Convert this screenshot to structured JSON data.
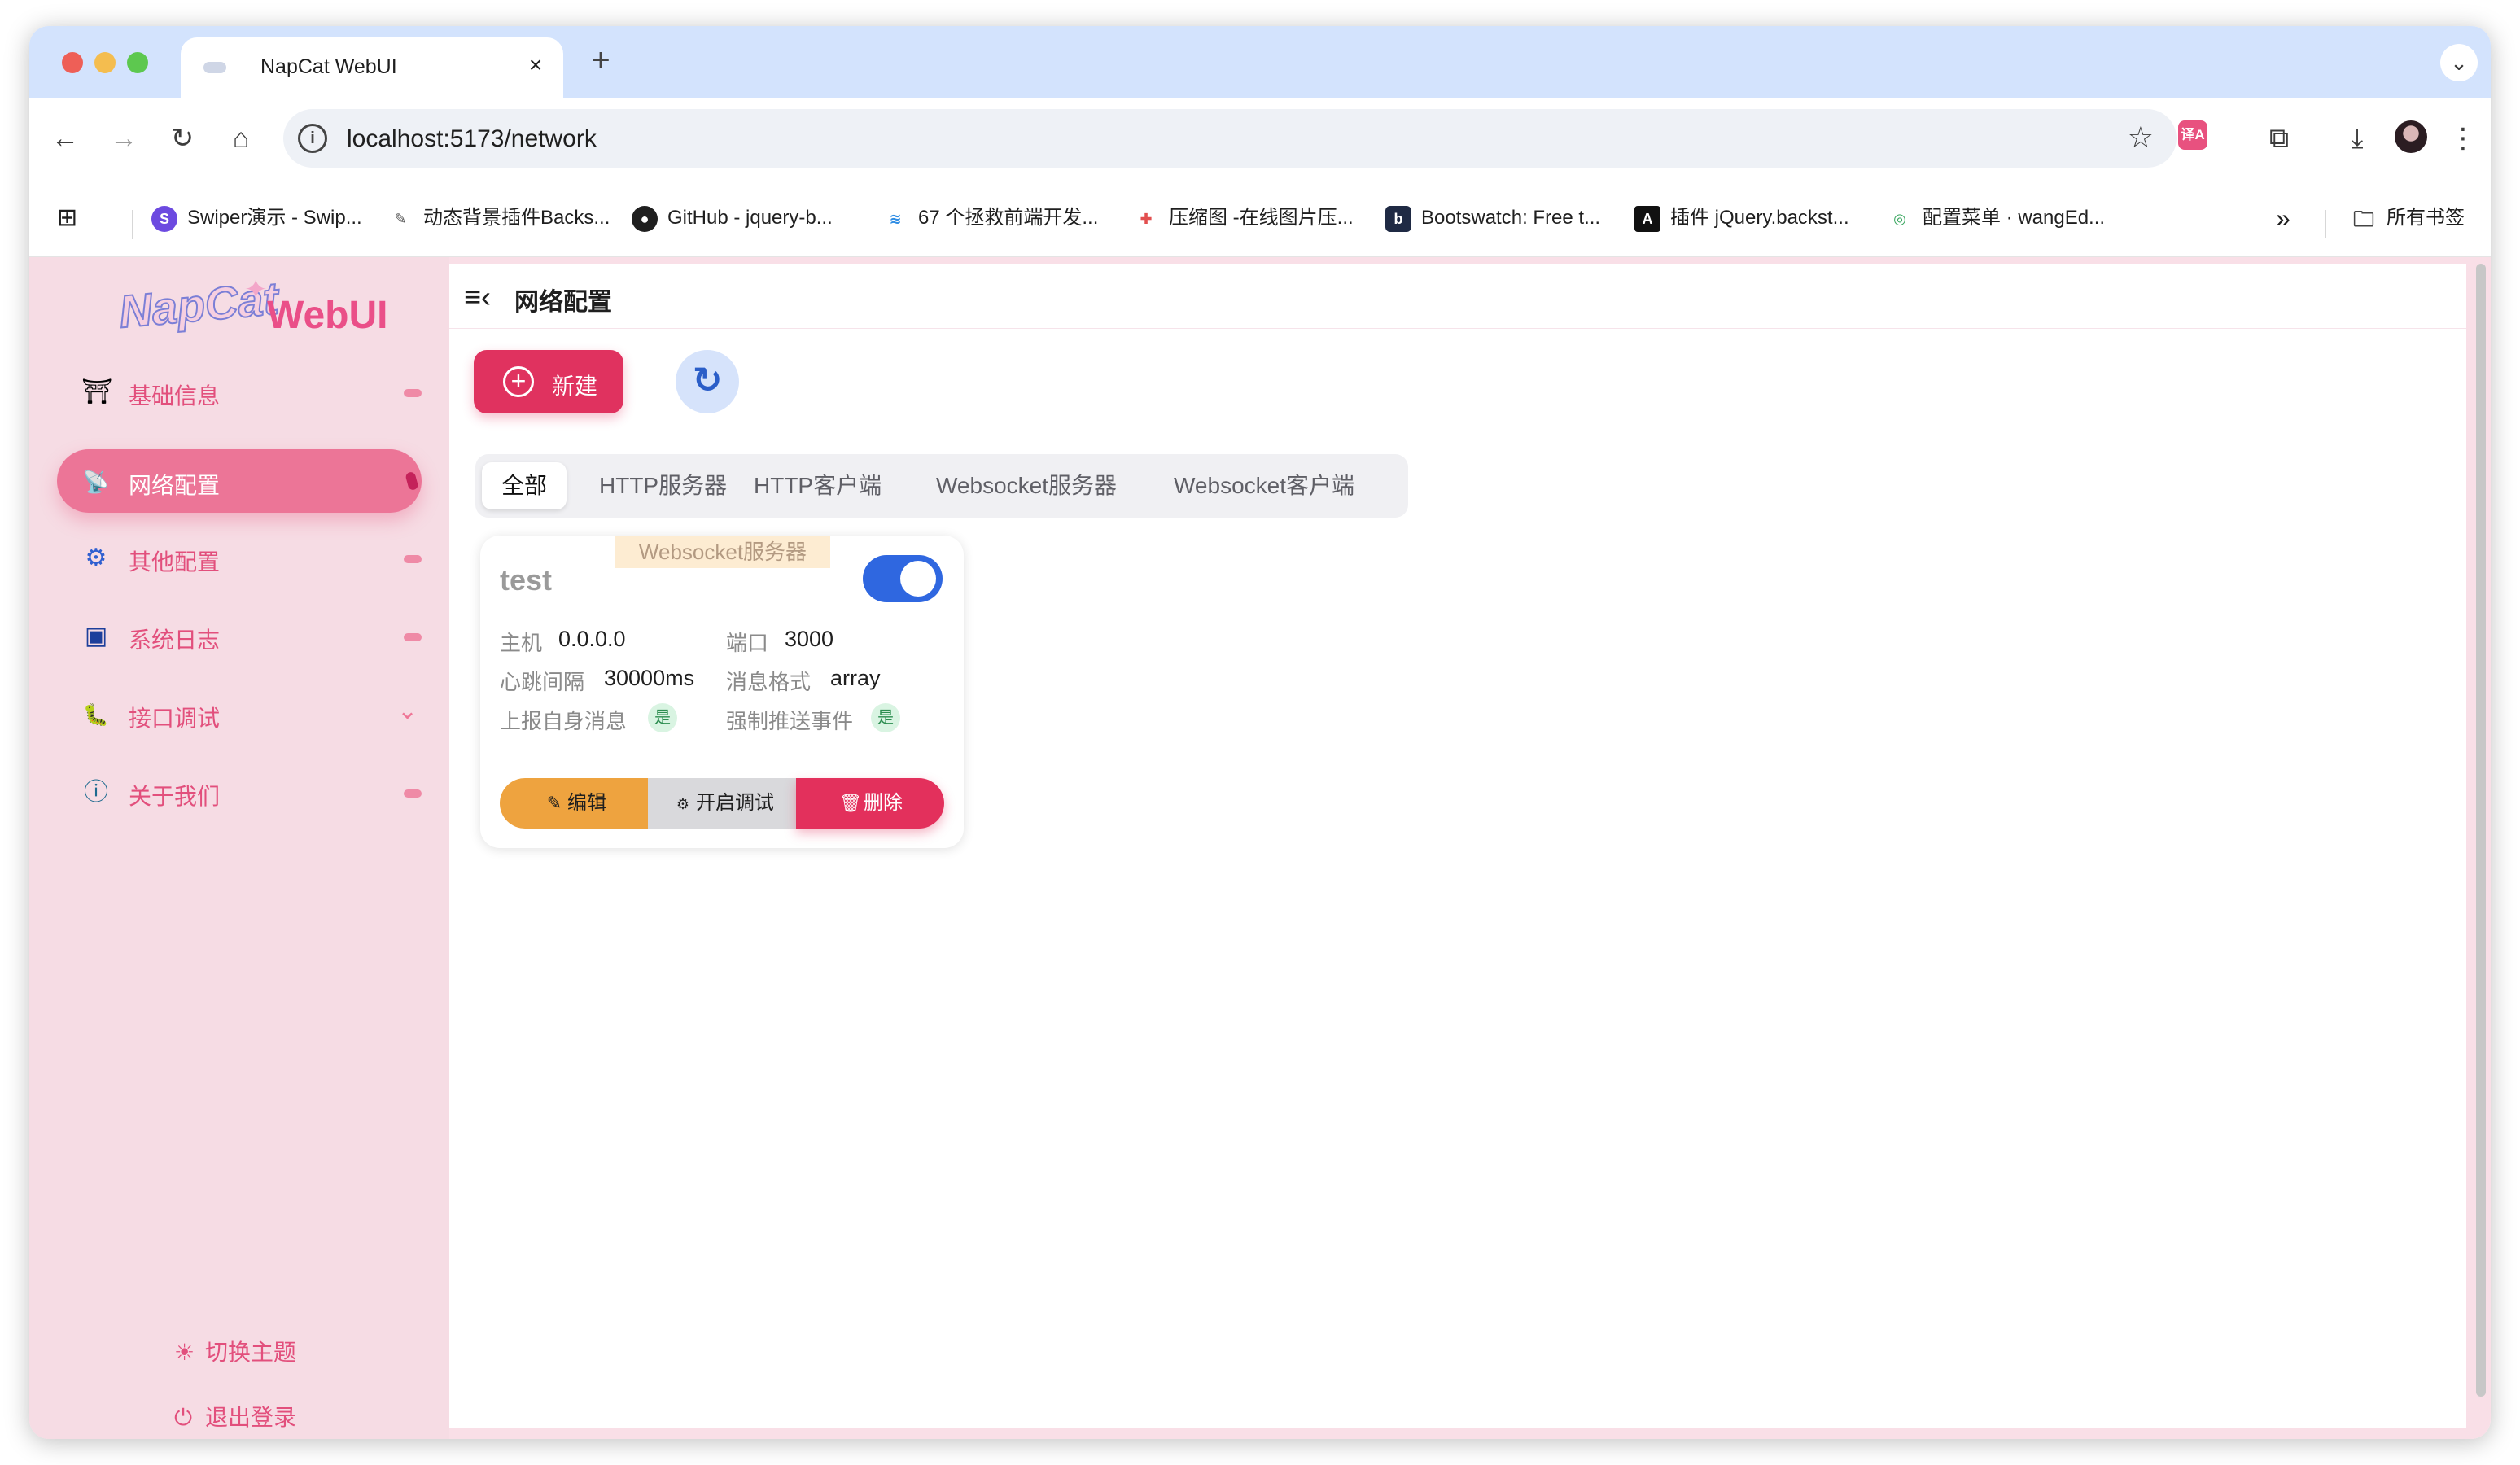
{
  "browser": {
    "tab_title": "NapCat WebUI",
    "tab_close": "×",
    "new_tab": "+",
    "tab_menu": "⌄",
    "url": "localhost:5173/network",
    "back": "←",
    "forward": "→",
    "reload": "↻",
    "home": "⌂",
    "bookmark_star": "☆",
    "extensions": "⧉",
    "download": "⤓",
    "menu": "⋮",
    "translate": "译A",
    "bookmarks": [
      {
        "label": "Swiper演示 - Swip...",
        "icon": "swiper-icon",
        "color": "#6c4ae0",
        "glyph": "S"
      },
      {
        "label": "动态背景插件Backs...",
        "icon": "pen-icon",
        "color": "#555555",
        "glyph": "✎"
      },
      {
        "label": "GitHub - jquery-b...",
        "icon": "github-icon",
        "color": "#1f1f1f",
        "glyph": "●"
      },
      {
        "label": "67 个拯救前端开发...",
        "icon": "stack-icon",
        "color": "#2f8de4",
        "glyph": "≋"
      },
      {
        "label": "压缩图 -在线图片压...",
        "icon": "compress-icon",
        "color": "#e24f4f",
        "glyph": "✚"
      },
      {
        "label": "Bootswatch: Free t...",
        "icon": "bootswatch-icon",
        "color": "#1f2a44",
        "glyph": "b"
      },
      {
        "label": "插件 jQuery.backst...",
        "icon": "a-icon",
        "color": "#111111",
        "glyph": "A"
      },
      {
        "label": "配置菜单 · wangEd...",
        "icon": "wang-icon",
        "color": "#3aa760",
        "glyph": "◎"
      }
    ],
    "bookmarks_more": "»",
    "all_bookmarks": "所有书签"
  },
  "app": {
    "logo_nap": "NapCat",
    "logo_web": "WebUI",
    "nav": [
      {
        "label": "基础信息",
        "icon": "dashboard-icon",
        "glyph": "⛩",
        "active": false,
        "expander": "dash"
      },
      {
        "label": "网络配置",
        "icon": "antenna-icon",
        "glyph": "📡",
        "active": true,
        "expander": "dash"
      },
      {
        "label": "其他配置",
        "icon": "gear-icon",
        "glyph": "⚙",
        "active": false,
        "expander": "dash"
      },
      {
        "label": "系统日志",
        "icon": "terminal-icon",
        "glyph": "▣",
        "active": false,
        "expander": "dash"
      },
      {
        "label": "接口调试",
        "icon": "bug-icon",
        "glyph": "🐛",
        "active": false,
        "expander": "chevron"
      },
      {
        "label": "关于我们",
        "icon": "info-icon",
        "glyph": "ⓘ",
        "active": false,
        "expander": "dash"
      }
    ],
    "switch_theme": "切换主题",
    "logout": "退出登录",
    "page_title": "网络配置",
    "new_button": "新建",
    "tabs": [
      "全部",
      "HTTP服务器",
      "HTTP客户端",
      "Websocket服务器",
      "Websocket客户端"
    ],
    "active_tab": 0,
    "card": {
      "type": "Websocket服务器",
      "name": "test",
      "enabled": true,
      "host_label": "主机",
      "host": "0.0.0.0",
      "port_label": "端口",
      "port": "3000",
      "heartbeat_label": "心跳间隔",
      "heartbeat": "30000ms",
      "format_label": "消息格式",
      "format": "array",
      "report_self_label": "上报自身消息",
      "report_self": "是",
      "force_push_label": "强制推送事件",
      "force_push": "是",
      "edit": "编辑",
      "debug": "开启调试",
      "delete": "删除"
    }
  },
  "colors": {
    "accent": "#e0325f",
    "sidebar_bg": "#f6dce4",
    "toggle_on": "#2f67e0",
    "edit": "#eea33f",
    "tabstrip": "#d3e3fd"
  }
}
